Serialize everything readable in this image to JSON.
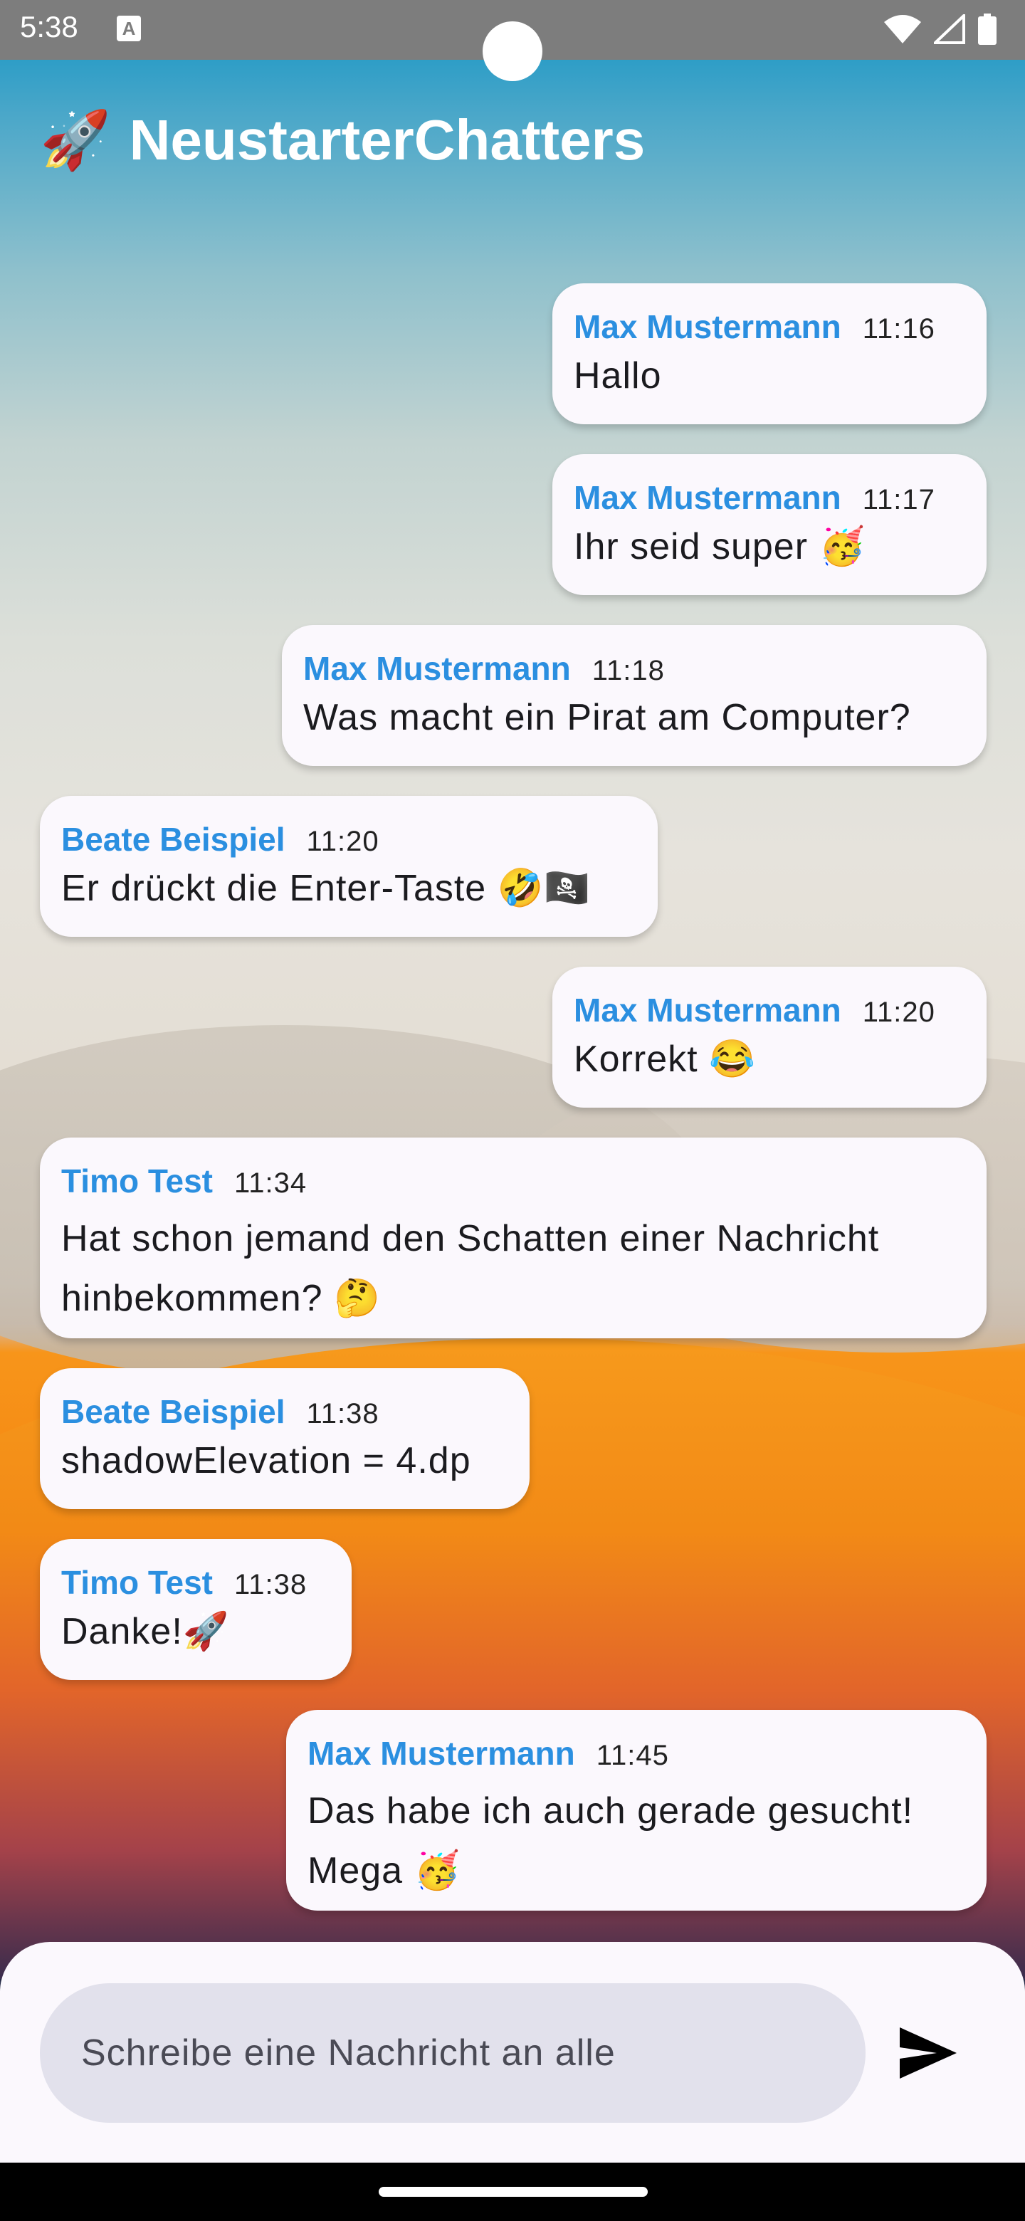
{
  "status_bar": {
    "time": "5:38",
    "notification_icon": "A",
    "icons": [
      "wifi-icon",
      "signal-icon",
      "battery-icon"
    ]
  },
  "app": {
    "title": "NeustarterChatters",
    "title_icon": "🚀"
  },
  "messages": [
    {
      "sender": "Max Mustermann",
      "time": "11:16",
      "text": "Hallo"
    },
    {
      "sender": "Max Mustermann",
      "time": "11:17",
      "text": "Ihr seid super 🥳"
    },
    {
      "sender": "Max Mustermann",
      "time": "11:18",
      "text": "Was macht ein Pirat am Computer?"
    },
    {
      "sender": "Beate Beispiel",
      "time": "11:20",
      "text": "Er drückt die Enter-Taste 🤣🏴‍☠️"
    },
    {
      "sender": "Max Mustermann",
      "time": "11:20",
      "text": "Korrekt 😂"
    },
    {
      "sender": "Timo Test",
      "time": "11:34",
      "text": "Hat schon jemand den Schatten einer Nachricht hinbekommen? 🤔"
    },
    {
      "sender": "Beate Beispiel",
      "time": "11:38",
      "text": "shadowElevation = 4.dp"
    },
    {
      "sender": "Timo Test",
      "time": "11:38",
      "text": "Danke!🚀"
    },
    {
      "sender": "Max Mustermann",
      "time": "11:45",
      "text": "Das habe ich auch gerade gesucht! Mega 🥳"
    }
  ],
  "composer": {
    "placeholder": "Schreibe eine Nachricht an alle",
    "send_icon": "send-icon"
  },
  "colors": {
    "accent": "#2b8fe0",
    "bubble": "#fbf8fd",
    "input": "#e2e1ec"
  }
}
